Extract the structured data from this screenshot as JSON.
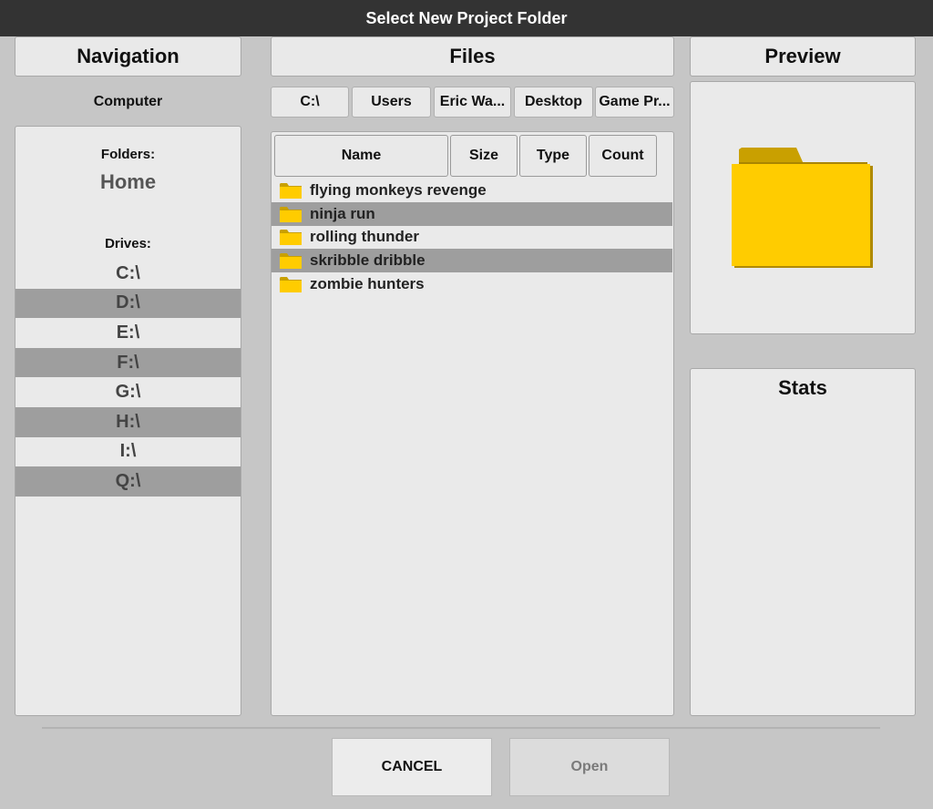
{
  "window": {
    "title": "Select New Project Folder"
  },
  "columns": {
    "navigation": "Navigation",
    "files": "Files",
    "preview": "Preview"
  },
  "navigation": {
    "location": "Computer",
    "folders_label": "Folders:",
    "home": "Home",
    "drives_label": "Drives:",
    "drives": [
      "C:\\",
      "D:\\",
      "E:\\",
      "F:\\",
      "G:\\",
      "H:\\",
      "I:\\",
      "Q:\\"
    ]
  },
  "breadcrumbs": [
    "C:\\",
    "Users",
    "Eric Wa...",
    "Desktop",
    "Game Pr..."
  ],
  "file_columns": [
    "Name",
    "Size",
    "Type",
    "Count"
  ],
  "files": [
    {
      "name": "flying monkeys revenge",
      "icon": "folder-icon"
    },
    {
      "name": "ninja run",
      "icon": "folder-icon"
    },
    {
      "name": "rolling thunder",
      "icon": "folder-icon"
    },
    {
      "name": "skribble dribble",
      "icon": "folder-icon"
    },
    {
      "name": "zombie hunters",
      "icon": "folder-icon"
    }
  ],
  "preview": {
    "icon": "folder-icon",
    "folder_color": "#ffcc00"
  },
  "stats": {
    "title": "Stats"
  },
  "buttons": {
    "cancel": "CANCEL",
    "open": "Open"
  },
  "colors": {
    "titlebar": "#333333",
    "background": "#c6c6c6",
    "panel": "#eaeaea",
    "row_alt": "#9e9e9e",
    "folder": "#ffcc00"
  }
}
